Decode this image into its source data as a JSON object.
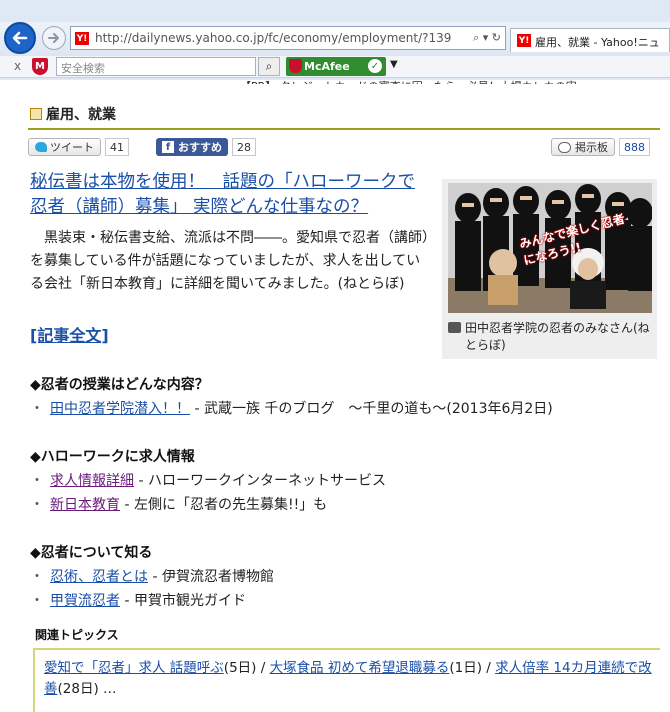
{
  "browser": {
    "url": "http://dailynews.yahoo.co.jp/fc/economy/employment/?139",
    "tab_title": "雇用、就業 - Yahoo!ニュ",
    "y_logo": "Y!",
    "search_placeholder": "安全検索",
    "mcafee_label": "McAfee",
    "close_x": "x",
    "peek_text": "【PR】 クレジットカードの審査に困ったら、必見！大場カレカの実"
  },
  "category": {
    "title": "雇用、就業"
  },
  "social": {
    "tweet_label": "ツイート",
    "tweet_count": "41",
    "fb_label": "おすすめ",
    "fb_count": "28",
    "board_label": "掲示板",
    "board_count": "888"
  },
  "article": {
    "headline": "秘伝書は本物を使用！　話題の「ハローワークで忍者（講師）募集」 実際どんな仕事なの？",
    "lead": "　黒装束・秘伝書支給、流派は不問――。愛知県で忍者（講師）を募集している件が話題になっていましたが、求人を出している会社「新日本教育」に詳細を聞いてみました。(ねとらぼ)",
    "full_link": "[記事全文]",
    "photo_text": "みんなで楽しく忍者になろう!!",
    "caption": "田中忍者学院の忍者のみなさん(ねとらぼ)"
  },
  "sections": [
    {
      "title": "◆忍者の授業はどんな内容？",
      "links": [
        {
          "text": "田中忍者学院潜入！！",
          "desc": " - 武蔵一族 千のブログ　～千里の道も～(2013年6月2日)",
          "visited": false
        }
      ]
    },
    {
      "title": "◆ハローワークに求人情報",
      "links": [
        {
          "text": "求人情報詳細",
          "desc": " - ハローワークインターネットサービス",
          "visited": true
        },
        {
          "text": "新日本教育",
          "desc": " - 左側に「忍者の先生募集!!」も",
          "visited": true
        }
      ]
    },
    {
      "title": "◆忍者について知る",
      "links": [
        {
          "text": "忍術、忍者とは",
          "desc": " - 伊賀流忍者博物館",
          "visited": false
        },
        {
          "text": "甲賀流忍者",
          "desc": " - 甲賀市観光ガイド",
          "visited": false
        }
      ]
    }
  ],
  "topics": {
    "title": "関連トピックス",
    "items": [
      {
        "text": "愛知で「忍者」求人 話題呼ぶ",
        "suffix": "(5日) / "
      },
      {
        "text": "大塚食品 初めて希望退職募る",
        "suffix": "(1日) / "
      },
      {
        "text": "求人倍率 14カ月連続で改善",
        "suffix": "(28日) …"
      }
    ]
  },
  "colors": {
    "accent_line": "#9aa11f",
    "link": "#1a4fa8",
    "visited": "#6a1b7a"
  }
}
